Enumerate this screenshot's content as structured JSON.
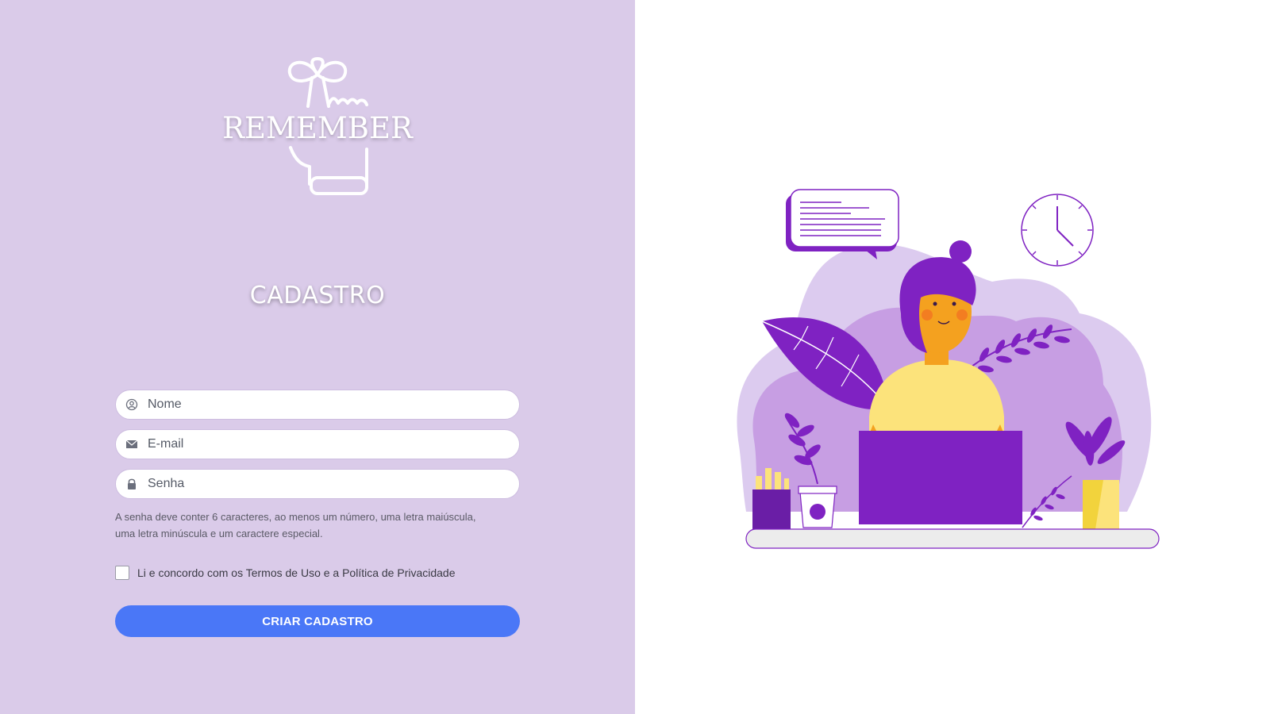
{
  "brand": {
    "logo_text": "REMEMBER"
  },
  "form": {
    "title": "CADASTRO",
    "name_placeholder": "Nome",
    "email_placeholder": "E-mail",
    "password_placeholder": "Senha",
    "password_hint_line1": "A senha deve conter 6 caracteres, ao menos um número, uma letra maiúscula,",
    "password_hint_line2": "uma letra minúscula e um caractere especial.",
    "terms_label": "Li e concordo com os Termos de Uso e a Política de Privacidade",
    "submit_label": "CRIAR CADASTRO"
  },
  "icons": {
    "name_field": "user-circle-icon",
    "email_field": "envelope-icon",
    "password_field": "lock-icon"
  },
  "colors": {
    "left_panel_bg": "#dacbe9",
    "primary_button": "#4a77f7",
    "illustration_purple": "#7f22c2",
    "illustration_lilac": "#c79ee3",
    "illustration_yellow": "#fce37b",
    "illustration_skin": "#f4a11f"
  }
}
